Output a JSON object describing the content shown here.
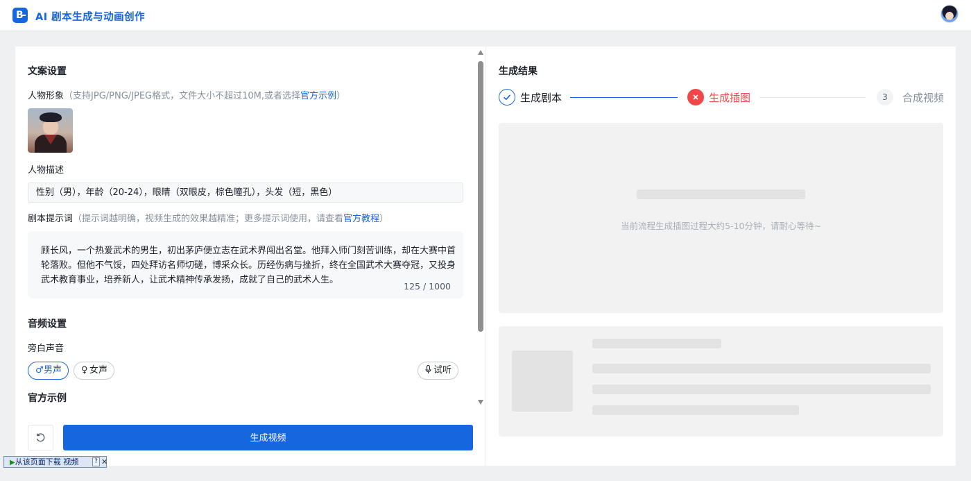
{
  "header": {
    "logo_text": "B",
    "title": "AI 剧本生成与动画创作"
  },
  "left": {
    "copy_section_title": "文案设置",
    "character_label": "人物形象",
    "character_hint": "（支持JPG/PNG/JPEG格式，文件大小不超过10M,或者选择",
    "character_link": "官方示例",
    "character_hint_end": "）",
    "description_label": "人物描述",
    "description_value": "性别（男），年龄（20-24），眼睛（双眼皮，棕色瞳孔），头发（短，黑色）",
    "prompt_label": "剧本提示词",
    "prompt_hint": "（提示词越明确，视频生成的效果越精准；更多提示词使用，请查看",
    "prompt_link": "官方教程",
    "prompt_hint_end": "）",
    "prompt_text": "顾长风，一个热爱武术的男生，初出茅庐便立志在武术界闯出名堂。他拜入师门刻苦训练，却在大赛中首轮落败。但他不气馁，四处拜访名师切磋，博采众长。历经伤病与挫折，终在全国武术大赛夺冠，又投身武术教育事业，培养新人，让武术精神传承发扬，成就了自己的武术人生。",
    "prompt_count": "125 / 1000",
    "audio_section_title": "音频设置",
    "narration_label": "旁白声音",
    "voice_male": "男声",
    "voice_female": "女声",
    "preview_label": "试听",
    "official_examples_title": "官方示例",
    "generate_button": "生成视频"
  },
  "right": {
    "result_title": "生成结果",
    "steps": [
      {
        "label": "生成剧本",
        "status": "done"
      },
      {
        "label": "生成插图",
        "status": "error"
      },
      {
        "label": "合成视频",
        "status": "pending",
        "number": "3"
      }
    ],
    "wait_message": "当前流程生成插图过程大约5-10分钟，请耐心等待~"
  },
  "download_bar": {
    "label": "从该页面下载 视频",
    "help": "?",
    "close": "✕"
  },
  "colors": {
    "brand": "#1666e0",
    "error": "#f04848"
  }
}
